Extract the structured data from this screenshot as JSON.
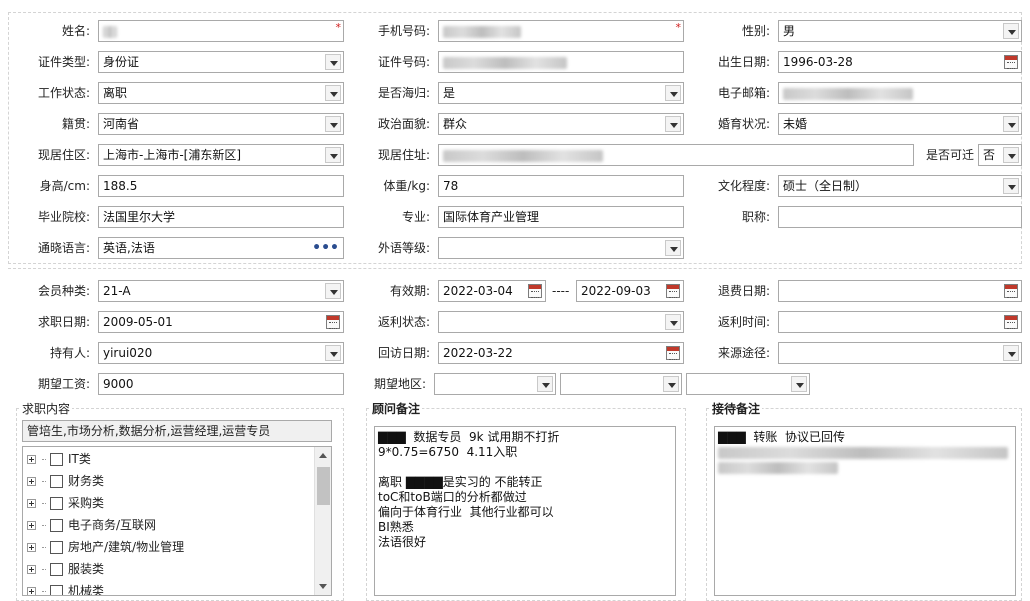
{
  "form": {
    "name": {
      "label": "姓名:",
      "value": "▇▇",
      "required": "*"
    },
    "mobile": {
      "label": "手机号码:",
      "value": "",
      "required": "*"
    },
    "gender": {
      "label": "性别:",
      "value": "男"
    },
    "id_type": {
      "label": "证件类型:",
      "value": "身份证"
    },
    "id_number": {
      "label": "证件号码:",
      "value": ""
    },
    "birth_date": {
      "label": "出生日期:",
      "value": "1996-03-28"
    },
    "work_status": {
      "label": "工作状态:",
      "value": "离职"
    },
    "overseas_return": {
      "label": "是否海归:",
      "value": "是"
    },
    "email": {
      "label": "电子邮箱:",
      "value": ""
    },
    "native_place": {
      "label": "籍贯:",
      "value": "河南省"
    },
    "political_status": {
      "label": "政治面貌:",
      "value": "群众"
    },
    "marital_status": {
      "label": "婚育状况:",
      "value": "未婚"
    },
    "residence_area": {
      "label": "现居住区:",
      "value": "上海市-上海市-[浦东新区]"
    },
    "residence_address": {
      "label": "现居住址:",
      "value": ""
    },
    "relocatable": {
      "label": "是否可迁",
      "value": "否"
    },
    "height": {
      "label": "身高/cm:",
      "value": "188.5"
    },
    "weight": {
      "label": "体重/kg:",
      "value": "78"
    },
    "education": {
      "label": "文化程度:",
      "value": "硕士（全日制）"
    },
    "school": {
      "label": "毕业院校:",
      "value": "法国里尔大学"
    },
    "major": {
      "label": "专业:",
      "value": "国际体育产业管理"
    },
    "title": {
      "label": "职称:",
      "value": ""
    },
    "languages": {
      "label": "通晓语言:",
      "value": "英语,法语",
      "more": "•••"
    },
    "foreign_level": {
      "label": "外语等级:",
      "value": ""
    }
  },
  "membership": {
    "member_type": {
      "label": "会员种类:",
      "value": "21-A"
    },
    "valid_period": {
      "label": "有效期:",
      "from": "2022-03-04",
      "sep": "----",
      "to": "2022-09-03"
    },
    "refund_date": {
      "label": "退费日期:",
      "value": ""
    },
    "job_seek_date": {
      "label": "求职日期:",
      "value": "2009-05-01"
    },
    "rebate_status": {
      "label": "返利状态:",
      "value": ""
    },
    "rebate_time": {
      "label": "返利时间:",
      "value": ""
    },
    "holder": {
      "label": "持有人:",
      "value": "yirui020"
    },
    "revisit_date": {
      "label": "回访日期:",
      "value": "2022-03-22"
    },
    "source": {
      "label": "来源途径:",
      "value": ""
    },
    "expected_salary": {
      "label": "期望工资:",
      "value": "9000"
    },
    "expected_region": {
      "label": "期望地区:",
      "values": [
        "",
        "",
        ""
      ]
    }
  },
  "job_content": {
    "title": "求职内容",
    "selected": "管培生,市场分析,数据分析,运营经理,运营专员",
    "categories": [
      "IT类",
      "财务类",
      "采购类",
      "电子商务/互联网",
      "房地产/建筑/物业管理",
      "服装类",
      "机械类"
    ]
  },
  "consultant_notes": {
    "title": "顾问备注",
    "lines": [
      "▇▇▇  数据专员  9k 试用期不打折",
      "9*0.75=6750  4.11入职",
      "",
      "离职 ▇▇▇▇是实习的 不能转正",
      "toC和toB端口的分析都做过",
      "偏向于体育行业  其他行业都可以",
      "BI熟悉",
      "法语很好"
    ]
  },
  "reception_notes": {
    "title": "接待备注",
    "lines": [
      "▇▇▇  转账  协议已回传"
    ]
  },
  "colors": {
    "required": "#d01d1d",
    "border": "#a9a9a9",
    "dashed": "#d4d4d4"
  }
}
